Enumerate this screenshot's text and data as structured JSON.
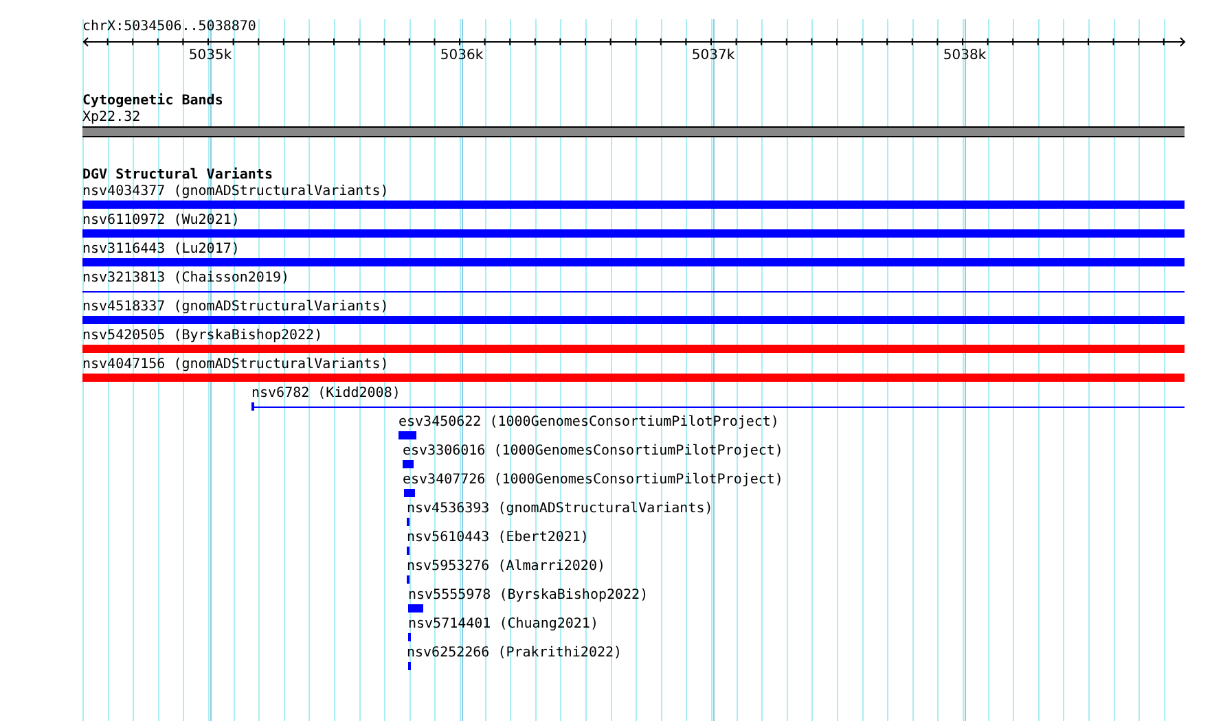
{
  "ruler": {
    "location": "chrX:5034506..5038870",
    "ticks": [
      "5035k",
      "5036k",
      "5037k",
      "5038k"
    ]
  },
  "cytogenetic_bands": {
    "title": "Cytogenetic Bands",
    "bands": [
      {
        "label": "Xp22.32"
      }
    ]
  },
  "structural_variants": {
    "title": "DGV Structural Variants",
    "variants": [
      {
        "label": "nsv4034377 (gnomADStructuralVariants)",
        "kind": "thick",
        "color": "#0000ff"
      },
      {
        "label": "nsv6110972 (Wu2021)",
        "kind": "thick",
        "color": "#0000ff"
      },
      {
        "label": "nsv3116443 (Lu2017)",
        "kind": "thick",
        "color": "#0000ff"
      },
      {
        "label": "nsv3213813 (Chaisson2019)",
        "kind": "thin",
        "color": "#0000ff"
      },
      {
        "label": "nsv4518337 (gnomADStructuralVariants)",
        "kind": "thick",
        "color": "#0000ff"
      },
      {
        "label": "nsv5420505 (ByrskaBishop2022)",
        "kind": "thick",
        "color": "#ff0000"
      },
      {
        "label": "nsv4047156 (gnomADStructuralVariants)",
        "kind": "thick",
        "color": "#ff0000"
      },
      {
        "label": "nsv6782 (Kidd2008)",
        "kind": "thin",
        "color": "#0000ff"
      },
      {
        "label": "esv3450622 (1000GenomesConsortiumPilotProject)",
        "kind": "thick",
        "color": "#0000ff"
      },
      {
        "label": "esv3306016 (1000GenomesConsortiumPilotProject)",
        "kind": "thick",
        "color": "#0000ff"
      },
      {
        "label": "esv3407726 (1000GenomesConsortiumPilotProject)",
        "kind": "thick",
        "color": "#0000ff"
      },
      {
        "label": "nsv4536393 (gnomADStructuralVariants)",
        "kind": "thick",
        "color": "#0000ff"
      },
      {
        "label": "nsv5610443 (Ebert2021)",
        "kind": "thick",
        "color": "#0000ff"
      },
      {
        "label": "nsv5953276 (Almarri2020)",
        "kind": "thick",
        "color": "#0000ff"
      },
      {
        "label": "nsv5555978 (ByrskaBishop2022)",
        "kind": "thick",
        "color": "#0000ff"
      },
      {
        "label": "nsv5714401 (Chuang2021)",
        "kind": "thick",
        "color": "#0000ff"
      },
      {
        "label": "nsv6252266 (Prakrithi2022)",
        "kind": "thick",
        "color": "#0000ff"
      }
    ]
  }
}
